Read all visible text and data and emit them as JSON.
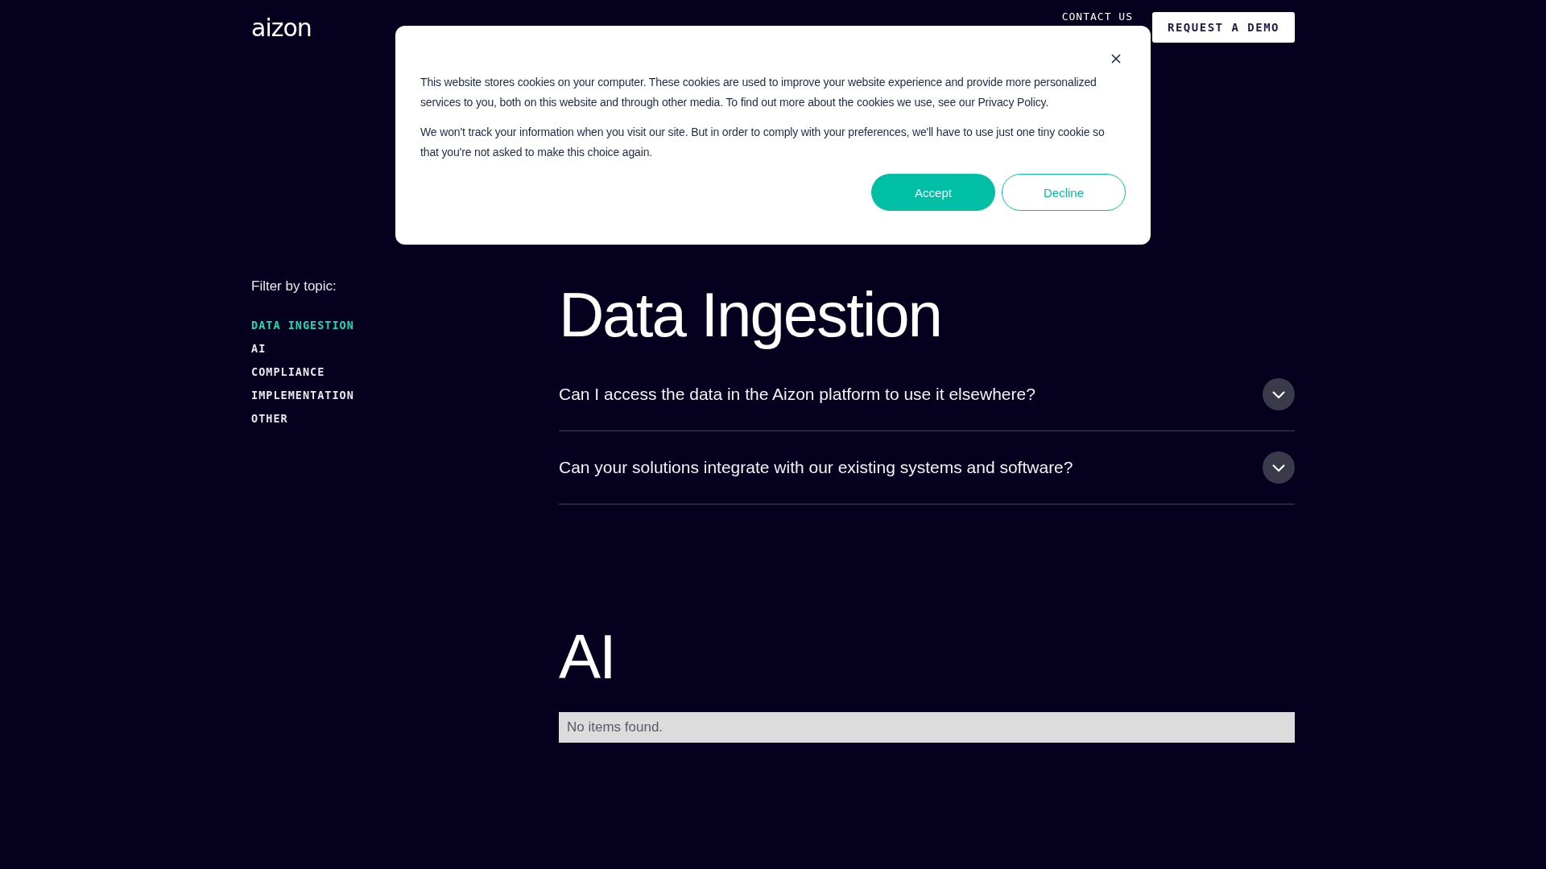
{
  "header": {
    "logo": "aizon",
    "contact_link": "CONTACT US",
    "demo_button": "REQUEST A DEMO"
  },
  "sidebar": {
    "label": "Filter by topic:",
    "topics": [
      {
        "label": "DATA INGESTION",
        "selected": true
      },
      {
        "label": "AI",
        "selected": false
      },
      {
        "label": "COMPLIANCE",
        "selected": false
      },
      {
        "label": "IMPLEMENTATION",
        "selected": false
      },
      {
        "label": "OTHER",
        "selected": false
      }
    ]
  },
  "sections": [
    {
      "title": "Data Ingestion",
      "questions": [
        {
          "text": "Can I access the data in the Aizon platform to use it elsewhere?",
          "expanded": false
        },
        {
          "text": "Can your solutions integrate with our existing systems and software?",
          "expanded": false
        }
      ]
    },
    {
      "title": "AI",
      "empty_message": "No items found."
    }
  ],
  "cookie_dialog": {
    "paragraphs": [
      "This website stores cookies on your computer. These cookies are used to improve your website experience and provide more personalized services to you, both on this website and through other media. To find out more about the cookies we use, see our Privacy Policy.",
      "We won't track your information when you visit our site. But in order to comply with your preferences, we'll have to use just one tiny cookie so that you're not asked to make this choice again."
    ],
    "accept": "Accept",
    "decline": "Decline"
  }
}
